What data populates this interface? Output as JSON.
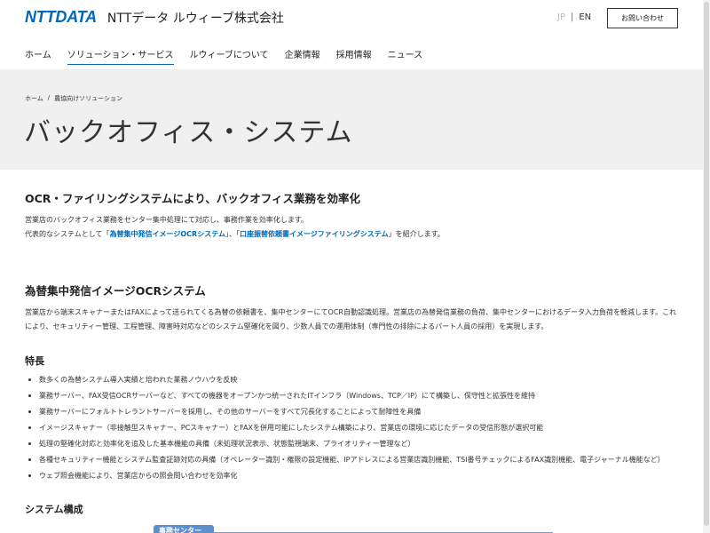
{
  "header": {
    "logo": "NTTDATA",
    "company": "NTTデータ ルウィーブ株式会社",
    "lang_jp": "JP",
    "lang_sep": "|",
    "lang_en": "EN",
    "contact": "お問い合わせ"
  },
  "nav": {
    "items": [
      "ホーム",
      "ソリューション・サービス",
      "ルウィーブについて",
      "企業情報",
      "採用情報",
      "ニュース"
    ],
    "active_index": 1
  },
  "hero": {
    "breadcrumb": [
      "ホーム",
      "/",
      "農協向けソリューション"
    ],
    "title": "バックオフィス・システム"
  },
  "intro": {
    "heading": "OCR・ファイリングシステムにより、バックオフィス業務を効率化",
    "line1": "営業店のバックオフィス業務をセンター集中処理にて対応し、事務作業を効率化します。",
    "line2_prefix": "代表的なシステムとして「",
    "link1": "為替集中発信イメージOCRシステム",
    "line2_mid": "」、「",
    "link2": "口座振替依頼書イメージファイリングシステム",
    "line2_suffix": "」を紹介します。"
  },
  "section1": {
    "heading": "為替集中発信イメージOCRシステム",
    "para_line1": "営業店から端末スキャナーまたはFAXによって送られてくる為替の依頼書を、集中センターにてOCR自動認識処理。営業店の為替発信業務の負荷、集中センターにおけるデータ入力負荷を軽減します。これ",
    "para_line2": "により、セキュリティー管理、工程管理、障害時対応などのシステム堅確化を図り、少数人員での運用体制（専門性の排除によるパート人員の採用）を実現します。",
    "features_heading": "特長",
    "features": [
      "数多くの為替システム導入実績と培われた業務ノウハウを反映",
      "業務サーバー、FAX受信OCRサーバーなど、すべての機器をオープンかつ統一されたITインフラ（Windows、TCP／IP）にて構築し、保守性と拡張性を維持",
      "業務サーバーにフォルトトレラントサーバーを採用し、その他のサーバーをすべて冗長化することによって耐障性を具備",
      "イメージスキャナー（非接触型スキャナー、PCスキャナー）とFAXを併用可能にしたシステム構築により、営業店の環境に応じたデータの受信形態が選択可能",
      "処理の堅確化対応と効率化を追及した基本機能の具備（未処理状況表示、状態監視端末、プライオリティー管理など）",
      "各種セキュリティー機能とシステム監査証跡対応の具備（オペレーター識別・権限の設定機能、IPアドレスによる営業店識別機能、TSI番号チェックによるFAX識別機能、電子ジャーナル機能など）",
      "ウェブ照会機能により、営業店からの照会問い合わせを効率化"
    ],
    "system_heading": "システム構成",
    "diagram_tab": "事務センター"
  },
  "colors": {
    "brand": "#0068b7",
    "hero_bg": "#f0f0f0",
    "diagram": "#5b8fce"
  }
}
